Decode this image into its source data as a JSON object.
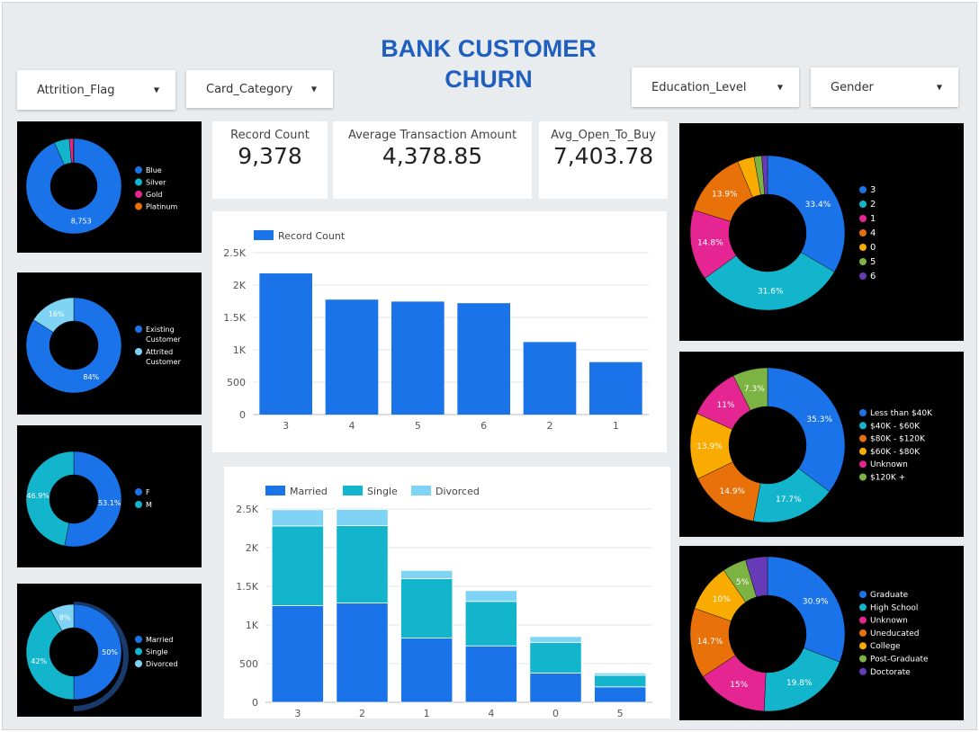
{
  "title_line1": "BANK CUSTOMER",
  "title_line2": "CHURN",
  "filters": {
    "attrition": "Attrition_Flag",
    "card": "Card_Category",
    "education": "Education_Level",
    "gender": "Gender"
  },
  "kpis": {
    "record_count_label": "Record Count",
    "record_count_value": "9,378",
    "avg_txn_label": "Average Transaction Amount",
    "avg_txn_value": "4,378.85",
    "open_to_buy_label": "Avg_Open_To_Buy",
    "open_to_buy_value": "7,403.78"
  },
  "colors": {
    "blue": "#1a73e8",
    "teal": "#12b5cb",
    "pink": "#e52592",
    "orange": "#e8710a",
    "yellow": "#f9ab00",
    "green": "#7cb342",
    "purple": "#673ab7",
    "lightblue": "#7fd4f5"
  },
  "chart_data": [
    {
      "type": "pie",
      "id": "card",
      "labels": [
        "Blue",
        "Silver",
        "Gold",
        "Platinum"
      ],
      "values": [
        8753,
        480,
        125,
        20
      ],
      "slice_labels": [
        "8,753",
        "",
        "",
        ""
      ]
    },
    {
      "type": "pie",
      "id": "attrition",
      "labels": [
        "Existing Customer",
        "Attrited Customer"
      ],
      "values": [
        84,
        16
      ],
      "slice_labels": [
        "84%",
        "16%"
      ]
    },
    {
      "type": "pie",
      "id": "gender",
      "labels": [
        "F",
        "M"
      ],
      "values": [
        53.1,
        46.9
      ],
      "slice_labels": [
        "53.1%",
        "46.9%"
      ]
    },
    {
      "type": "pie",
      "id": "marital",
      "labels": [
        "Married",
        "Single",
        "Divorced"
      ],
      "values": [
        50,
        42,
        8
      ],
      "slice_labels": [
        "50%",
        "42%",
        "8%"
      ]
    },
    {
      "type": "bar",
      "id": "dependents",
      "legend": "Record Count",
      "categories": [
        "3",
        "4",
        "5",
        "6",
        "2",
        "1"
      ],
      "values": [
        2180,
        1775,
        1745,
        1720,
        1120,
        810
      ],
      "yticks": [
        "0",
        "500",
        "1K",
        "1.5K",
        "2K",
        "2.5K"
      ],
      "ylim": [
        0,
        2500
      ]
    },
    {
      "type": "bar",
      "id": "stacked",
      "stacked": true,
      "categories": [
        "3",
        "2",
        "1",
        "4",
        "0",
        "5"
      ],
      "series": [
        {
          "name": "Married",
          "values": [
            1250,
            1285,
            830,
            730,
            380,
            200
          ]
        },
        {
          "name": "Single",
          "values": [
            1030,
            1000,
            770,
            575,
            395,
            150
          ]
        },
        {
          "name": "Divorced",
          "values": [
            210,
            210,
            105,
            140,
            75,
            30
          ]
        }
      ],
      "yticks": [
        "0",
        "500",
        "1K",
        "1.5K",
        "2K",
        "2.5K"
      ],
      "ylim": [
        0,
        2500
      ]
    },
    {
      "type": "pie",
      "id": "dep_pie",
      "labels": [
        "3",
        "2",
        "1",
        "4",
        "0",
        "5",
        "6"
      ],
      "values": [
        33.4,
        31.6,
        14.8,
        13.9,
        3.5,
        1.6,
        1.2
      ],
      "slice_labels": [
        "33.4%",
        "31.6%",
        "14.8%",
        "13.9%",
        "",
        "",
        ""
      ]
    },
    {
      "type": "pie",
      "id": "income",
      "labels": [
        "Less than $40K",
        "$40K - $60K",
        "$80K - $120K",
        "$60K - $80K",
        "Unknown",
        "$120K +"
      ],
      "values": [
        35.3,
        17.7,
        14.9,
        13.9,
        11,
        7.3
      ],
      "slice_labels": [
        "35.3%",
        "17.7%",
        "14.9%",
        "13.9%",
        "11%",
        "7.3%"
      ]
    },
    {
      "type": "pie",
      "id": "education",
      "labels": [
        "Graduate",
        "High School",
        "Unknown",
        "Uneducated",
        "College",
        "Post-Graduate",
        "Doctorate"
      ],
      "values": [
        30.9,
        19.8,
        15,
        14.7,
        10,
        5,
        4.6
      ],
      "slice_labels": [
        "30.9%",
        "19.8%",
        "15%",
        "14.7%",
        "10%",
        "5%",
        ""
      ]
    }
  ]
}
